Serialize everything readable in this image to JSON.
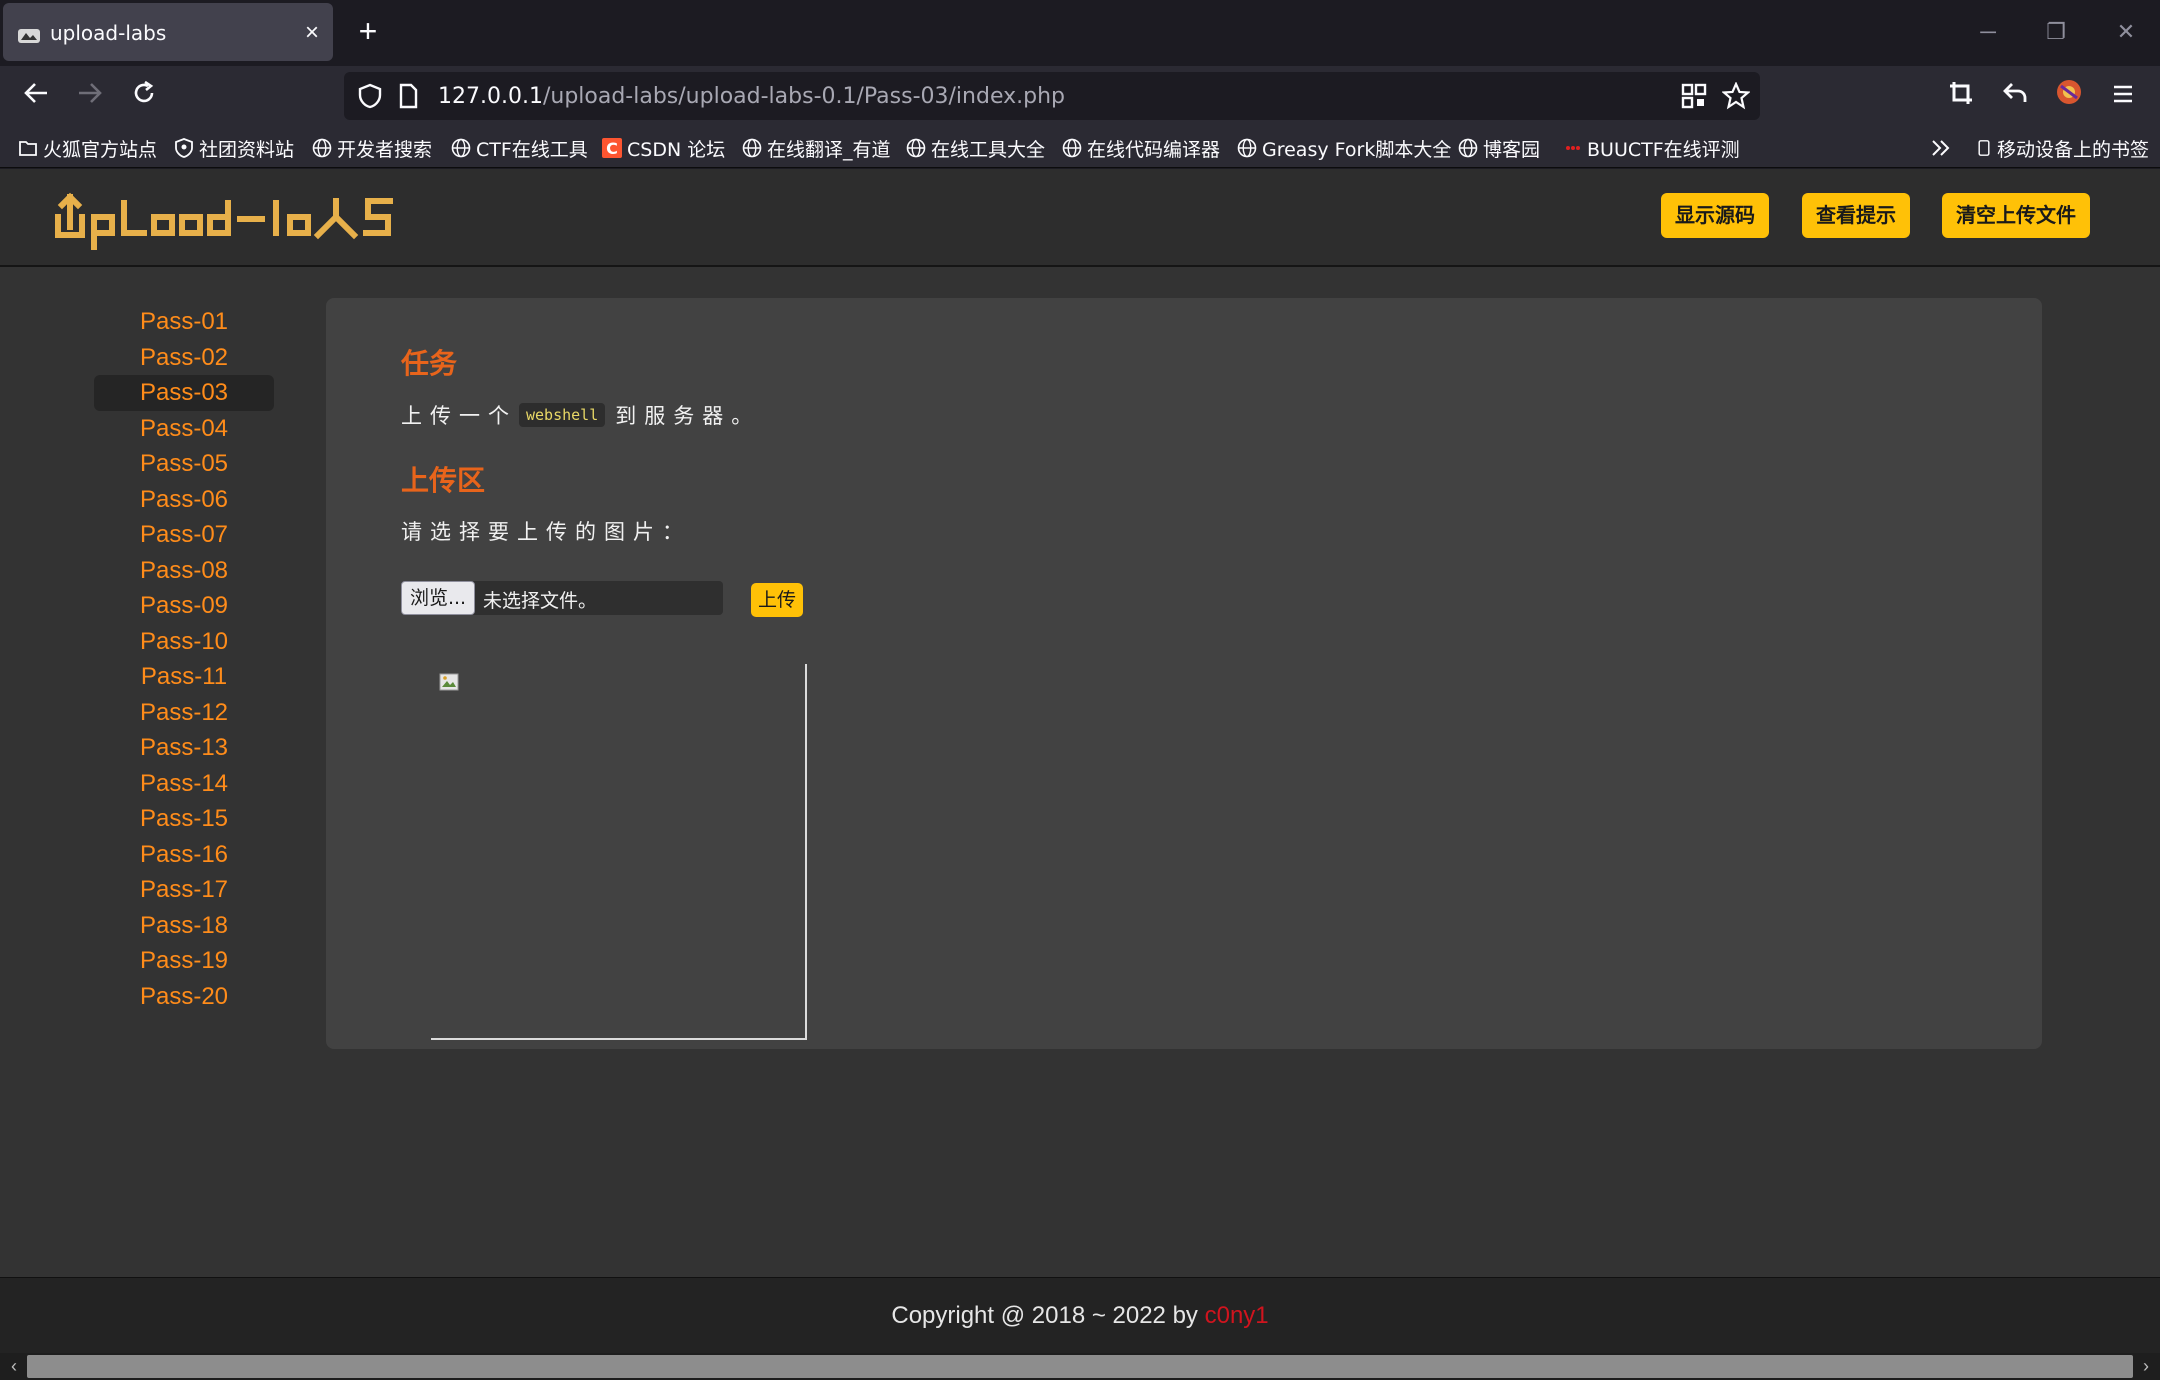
{
  "browser": {
    "tab_title": "upload-labs",
    "url_host": "127.0.0.1",
    "url_path": "/upload-labs/upload-labs-0.1/Pass-03/index.php",
    "bookmarks": [
      {
        "label": "火狐官方站点",
        "icon": "folder-icon"
      },
      {
        "label": "社团资料站",
        "icon": "shield-icon"
      },
      {
        "label": "开发者搜索",
        "icon": "globe-icon"
      },
      {
        "label": "CTF在线工具",
        "icon": "globe-icon"
      },
      {
        "label": "CSDN 论坛",
        "icon": "csdn-icon"
      },
      {
        "label": "在线翻译_有道",
        "icon": "globe-icon"
      },
      {
        "label": "在线工具大全",
        "icon": "globe-icon"
      },
      {
        "label": "在线代码编译器",
        "icon": "globe-icon"
      },
      {
        "label": "Greasy Fork脚本大全",
        "icon": "globe-icon"
      },
      {
        "label": "博客园",
        "icon": "globe-icon"
      },
      {
        "label": "BUUCTF在线评测",
        "icon": "buuctf-icon"
      }
    ],
    "mobile_bookmarks": "移动设备上的书签"
  },
  "header": {
    "logo_text": "Upload-labs",
    "buttons": {
      "show_source": "显示源码",
      "view_hint": "查看提示",
      "clear_uploads": "清空上传文件"
    }
  },
  "sidebar": {
    "active": "Pass-03",
    "items": [
      "Pass-01",
      "Pass-02",
      "Pass-03",
      "Pass-04",
      "Pass-05",
      "Pass-06",
      "Pass-07",
      "Pass-08",
      "Pass-09",
      "Pass-10",
      "Pass-11",
      "Pass-12",
      "Pass-13",
      "Pass-14",
      "Pass-15",
      "Pass-16",
      "Pass-17",
      "Pass-18",
      "Pass-19",
      "Pass-20"
    ]
  },
  "main": {
    "task_title": "任务",
    "task_before": "上传一个",
    "task_code": "webshell",
    "task_after": "到服务器。",
    "upload_title": "上传区",
    "choose_label": "请选择要上传的图片：",
    "browse_label": "浏览...",
    "no_file": "未选择文件。",
    "submit_label": "上传"
  },
  "footer": {
    "text": "Copyright @ 2018 ~ 2022 by ",
    "author": "c0ny1"
  },
  "colors": {
    "accent_orange": "#e8641b",
    "link_orange": "#ff8c1a",
    "button_yellow": "#ffc107",
    "author_red": "#d0141e"
  }
}
